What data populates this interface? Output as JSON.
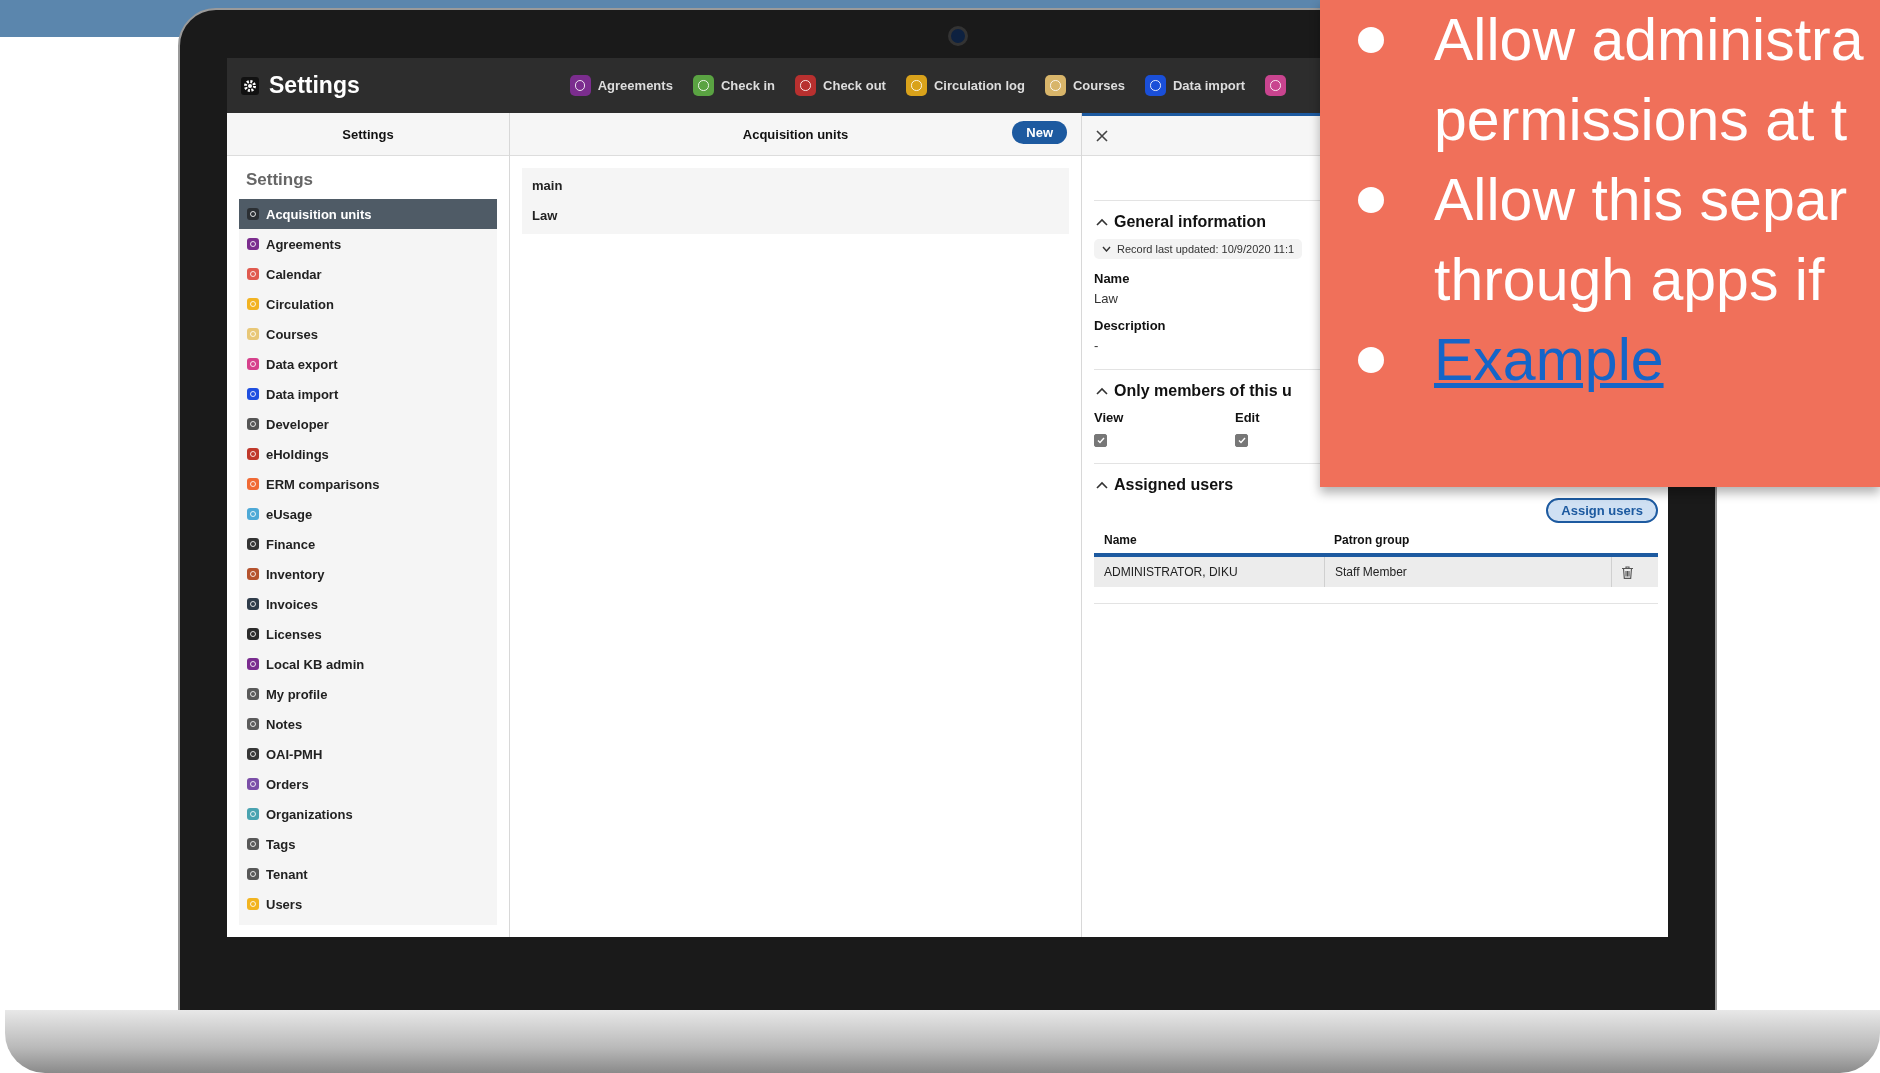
{
  "slide": {
    "bullets": [
      {
        "kind": "text",
        "lines": [
          "Allow administra",
          "permissions at t"
        ]
      },
      {
        "kind": "text",
        "lines": [
          "Allow this separ",
          "through apps if"
        ]
      },
      {
        "kind": "link",
        "lines": [
          "Example"
        ]
      }
    ]
  },
  "screen": {
    "app_title": "Settings",
    "nav": [
      {
        "label": "Agreements",
        "color": "#7b2d8e"
      },
      {
        "label": "Check in",
        "color": "#5aa342"
      },
      {
        "label": "Check out",
        "color": "#b8302f"
      },
      {
        "label": "Circulation log",
        "color": "#d9a21b"
      },
      {
        "label": "Courses",
        "color": "#d8b56a"
      },
      {
        "label": "Data import",
        "color": "#1a4fd8"
      },
      {
        "color": "#c9448f"
      }
    ],
    "settings_pane": {
      "title": "Settings",
      "heading": "Settings",
      "items": [
        {
          "label": "Acquisition units",
          "color": "#2b2f33",
          "selected": true
        },
        {
          "label": "Agreements",
          "color": "#7b2d8e",
          "selected": false
        },
        {
          "label": "Calendar",
          "color": "#e05a4f",
          "selected": false
        },
        {
          "label": "Circulation",
          "color": "#f2b322",
          "selected": false
        },
        {
          "label": "Courses",
          "color": "#e8c777",
          "selected": false
        },
        {
          "label": "Data export",
          "color": "#d6418c",
          "selected": false
        },
        {
          "label": "Data import",
          "color": "#1f4fe0",
          "selected": false
        },
        {
          "label": "Developer",
          "color": "#555555",
          "selected": false
        },
        {
          "label": "eHoldings",
          "color": "#c0392b",
          "selected": false
        },
        {
          "label": "ERM comparisons",
          "color": "#f06a35",
          "selected": false
        },
        {
          "label": "eUsage",
          "color": "#4ea9d6",
          "selected": false
        },
        {
          "label": "Finance",
          "color": "#333333",
          "selected": false
        },
        {
          "label": "Inventory",
          "color": "#b5532e",
          "selected": false
        },
        {
          "label": "Invoices",
          "color": "#2f3c4a",
          "selected": false
        },
        {
          "label": "Licenses",
          "color": "#2b2b2b",
          "selected": false
        },
        {
          "label": "Local KB admin",
          "color": "#7a2c8f",
          "selected": false
        },
        {
          "label": "My profile",
          "color": "#5a5a5a",
          "selected": false
        },
        {
          "label": "Notes",
          "color": "#5b5b5b",
          "selected": false
        },
        {
          "label": "OAI-PMH",
          "color": "#363636",
          "selected": false
        },
        {
          "label": "Orders",
          "color": "#7b4fa8",
          "selected": false
        },
        {
          "label": "Organizations",
          "color": "#4aa3b0",
          "selected": false
        },
        {
          "label": "Tags",
          "color": "#585858",
          "selected": false
        },
        {
          "label": "Tenant",
          "color": "#575757",
          "selected": false
        },
        {
          "label": "Users",
          "color": "#f2b420",
          "selected": false
        }
      ]
    },
    "units_pane": {
      "title": "Acquisition units",
      "new_button": "New",
      "units": [
        "main",
        "Law"
      ]
    },
    "detail_pane": {
      "general": {
        "heading": "General information",
        "expanded": true,
        "record": "Record last updated: 10/9/2020 11:1",
        "fields": [
          {
            "label": "Name",
            "value": "Law"
          },
          {
            "label": "Description",
            "value": "-"
          }
        ]
      },
      "permissions": {
        "heading": "Only members of this u",
        "expanded": true,
        "columns": [
          {
            "label": "View",
            "checked": true
          },
          {
            "label": "Edit",
            "checked": true
          }
        ]
      },
      "assigned": {
        "heading": "Assigned users",
        "expanded": true,
        "button": "Assign users",
        "columns": [
          "Name",
          "Patron group"
        ],
        "rows": [
          [
            "ADMINISTRATOR, DIKU",
            "Staff Member"
          ]
        ]
      }
    }
  }
}
